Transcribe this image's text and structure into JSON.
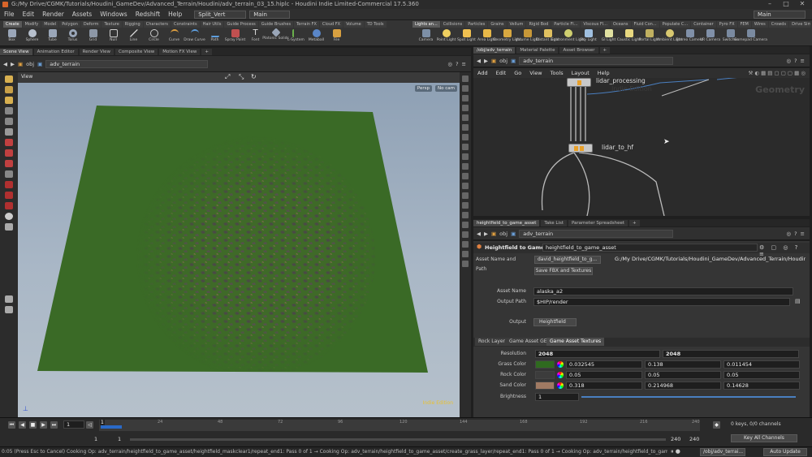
{
  "window": {
    "title": "G:/My Drive/CGMK/Tutorials/Houdini_GameDev/Advanced_Terrain/Houdini/adv_terrain_03_15.hiplc - Houdini Indie Limited-Commercial 17.5.360"
  },
  "menubar": {
    "items": [
      "File",
      "Edit",
      "Render",
      "Assets",
      "Windows",
      "Redshift",
      "Help"
    ],
    "desktop": "Split_Vert",
    "context": "Main",
    "right_desktop": "Main"
  },
  "shelf": {
    "left_tabs": [
      "Create",
      "Modify",
      "Model",
      "Polygon",
      "Deform",
      "Texture",
      "Rigging",
      "Characters",
      "Constraints",
      "Hair Utils",
      "Guide Process",
      "Guide Brushes",
      "Terrain FX",
      "Cloud FX",
      "Volume",
      "TD Tools"
    ],
    "left_tools": [
      "Box",
      "Sphere",
      "Tube",
      "Torus",
      "Grid",
      "Null",
      "Line",
      "Circle",
      "Curve",
      "Draw Curve",
      "Path",
      "Spray Paint",
      "Font",
      "Platonic Solids",
      "L-System",
      "Metaball",
      "File"
    ],
    "right_tabs": [
      "Lights an...",
      "Collisions",
      "Particles",
      "Grains",
      "Vellum",
      "Rigid Bod",
      "Particle Fl...",
      "Viscous Fl...",
      "Oceans",
      "Fluid Con...",
      "Populate C...",
      "Container",
      "Pyro FX",
      "FEM",
      "Wires",
      "Crowds",
      "Drive Sim"
    ],
    "right_tools": [
      "Camera",
      "Point Light",
      "Spot Light",
      "Area Light",
      "Geometry Light",
      "Volume Light",
      "Distant Light",
      "Environment Light",
      "Sky Light",
      "GI Light",
      "Caustic Light",
      "Portal Light",
      "Ambient Light",
      "Stereo Camera",
      "VR Camera",
      "Switcher",
      "Gamepad Camera"
    ]
  },
  "left_panel": {
    "tabs": [
      "Scene View",
      "Animation Editor",
      "Render View",
      "Composite View",
      "Motion FX View"
    ],
    "path": [
      "obj",
      "adv_terrain"
    ],
    "view_label": "View",
    "persp": "Persp",
    "cam": "No cam",
    "watermark": "Indie Edition"
  },
  "network_panel": {
    "tabs": [
      "/obj/adv_terrain",
      "Material Palette",
      "Asset Browser"
    ],
    "path": [
      "obj",
      "adv_terrain"
    ],
    "menu": [
      "Add",
      "Edit",
      "Go",
      "View",
      "Tools",
      "Layout",
      "Help"
    ],
    "context_label": "Geometry",
    "watermark": "Indie Edition",
    "nodes": [
      "lidar_processing",
      "lidar_to_hf"
    ]
  },
  "params_panel": {
    "tabs": [
      "heightfield_to_game_asset",
      "Take List",
      "Parameter Spreadsheet"
    ],
    "path": [
      "obj",
      "adv_terrain"
    ],
    "node_type": "Heightfield to Game Asset",
    "node_name": "heightfield_to_game_asset",
    "asset_name_path_label": "Asset Name and Path",
    "asset_name_short": "david_heightfield_to_g...",
    "asset_path": "G:/My Drive/CGMK/Tutorials/Houdini_GameDev/Advanced_Terrain/Houdini/hda/dav...",
    "save_button": "Save FBX and Textures",
    "asset_name_label": "Asset Name",
    "asset_name": "alaska_a2",
    "output_path_label": "Output Path",
    "output_path": "$HIP/render",
    "output_label": "Output",
    "output_value": "Heightfield",
    "subtabs": [
      "Rock Layer",
      "Game Asset GEO",
      "Game Asset Textures"
    ],
    "resolution_label": "Resolution",
    "resolution": [
      "2048",
      "2048"
    ],
    "grass_label": "Grass Color",
    "grass_values": [
      "0.032545",
      "0.138",
      "0.011454"
    ],
    "grass_swatch": "#2f6a1f",
    "rock_label": "Rock Color",
    "rock_values": [
      "0.05",
      "0.05",
      "0.05"
    ],
    "rock_swatch": "#3c3c3c",
    "sand_label": "Sand Color",
    "sand_values": [
      "0.318",
      "0.214968",
      "0.14628"
    ],
    "sand_swatch": "#a07a63",
    "brightness_label": "Brightness",
    "brightness": "1"
  },
  "timeline": {
    "current_frame": "1",
    "ticks": [
      "1",
      "24",
      "48",
      "72",
      "96",
      "120",
      "144",
      "168",
      "192",
      "216",
      "240"
    ],
    "start": "1",
    "start2": "1",
    "end": "240",
    "end2": "240",
    "keys": "0 keys, 0/0 channels",
    "key_all": "Key All Channels"
  },
  "status": {
    "text": "0:05 (Press Esc to Cancel) Cooking Op: adv_terrain/heightfield_to_game_asset/heightfield_maskclear1/repeat_end1: Pass 0 of 1 → Cooking Op: adv_terrain/heightfield_to_game_asset/create_grass_layer/repeat_end1: Pass 0 of 1 → Cooking Op: adv_terrain/heightfield_to_game_asset/create_rock_layer/repeat_end1: Pass 0 of 1 → C",
    "path": "/obj/adv_terrai...",
    "auto_update": "Auto Update"
  }
}
